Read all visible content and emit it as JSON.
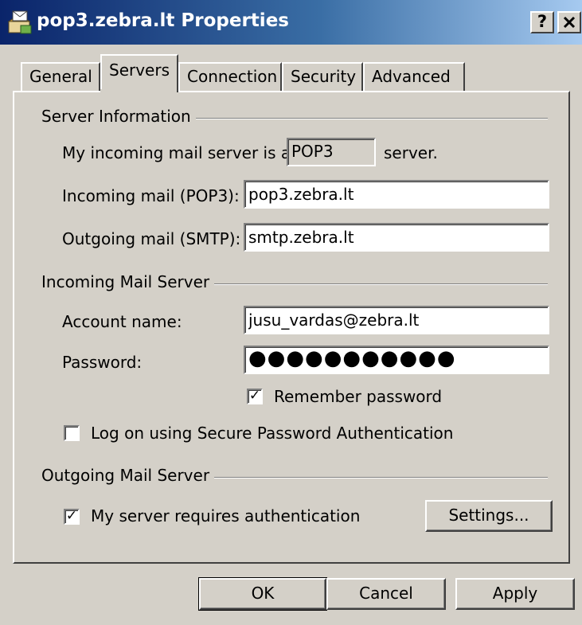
{
  "window": {
    "title": "pop3.zebra.lt Properties",
    "help_glyph": "?",
    "close_glyph": "✕"
  },
  "tabs": [
    {
      "label": "General",
      "active": false
    },
    {
      "label": "Servers",
      "active": true
    },
    {
      "label": "Connection",
      "active": false
    },
    {
      "label": "Security",
      "active": false
    },
    {
      "label": "Advanced",
      "active": false
    }
  ],
  "server_information": {
    "heading": "Server Information",
    "server_type_prefix": "My incoming mail server is a",
    "server_type_value": "POP3",
    "server_type_suffix": "server.",
    "incoming_label": "Incoming mail (POP3):",
    "incoming_value": "pop3.zebra.lt",
    "outgoing_label": "Outgoing mail (SMTP):",
    "outgoing_value": "smtp.zebra.lt"
  },
  "incoming_mail_server": {
    "heading": "Incoming Mail Server",
    "account_label": "Account name:",
    "account_value": "jusu_vardas@zebra.lt",
    "password_label": "Password:",
    "password_mask": "●●●●●●●●●●●",
    "remember_label": "Remember password",
    "remember_checked": true,
    "spa_label": "Log on using Secure Password Authentication",
    "spa_checked": false
  },
  "outgoing_mail_server": {
    "heading": "Outgoing Mail Server",
    "auth_label": "My server requires authentication",
    "auth_checked": true,
    "settings_button": "Settings..."
  },
  "buttons": {
    "ok": "OK",
    "cancel": "Cancel",
    "apply": "Apply"
  },
  "colors": {
    "titlebar_start": "#0a246a",
    "titlebar_end": "#a6caf0",
    "dialog_face": "#d4d0c8"
  },
  "icons": {
    "title": "mail-server-icon"
  }
}
